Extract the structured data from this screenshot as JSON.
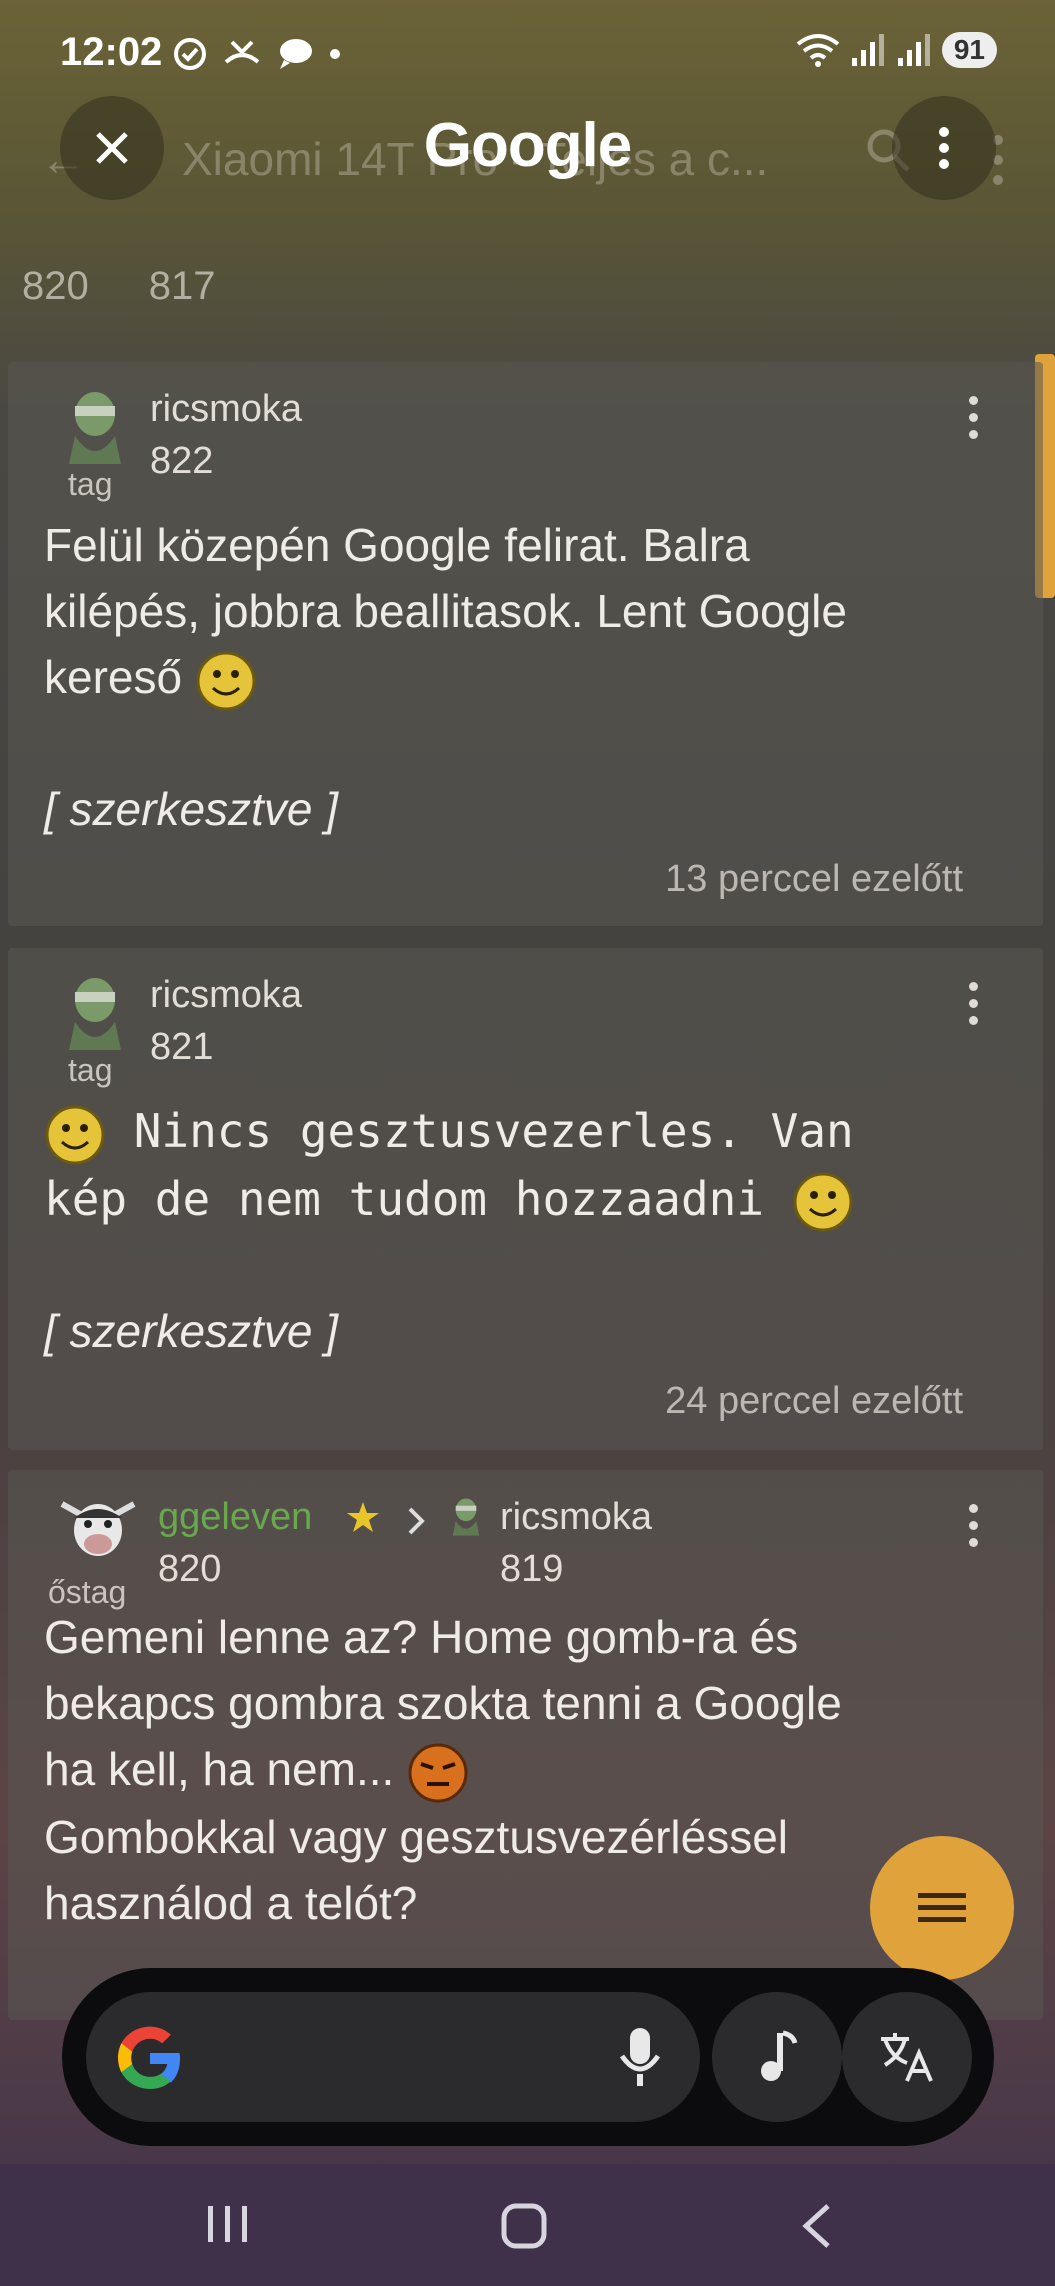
{
  "status_bar": {
    "time": "12:02",
    "battery": "91"
  },
  "header": {
    "title": "Google",
    "search_text": "Xiaomi 14T Pro - Teljes a c...",
    "close_icon": "close-icon",
    "menu_icon": "more-vert-icon"
  },
  "pages": [
    "820",
    "817"
  ],
  "posts": [
    {
      "author": "ricsmoka",
      "rank": "tag",
      "number": "822",
      "text_line1": "Felül közepén Google felirat. Balra",
      "text_line2": "kilépés, jobbra beallitasok. Lent Google",
      "text_line3": "kereső",
      "edited": "[ szerkesztve ]",
      "time": "13 perccel ezelőtt"
    },
    {
      "author": "ricsmoka",
      "rank": "tag",
      "number": "821",
      "text_line1": " Nincs gesztusvezerles. Van",
      "text_line2": "kép de nem tudom hozzaadni",
      "edited": "[ szerkesztve ]",
      "time": "24 perccel ezelőtt"
    },
    {
      "author": "ggeleven",
      "rank": "őstag",
      "number": "820",
      "reply_to_author": "ricsmoka",
      "reply_to_number": "819",
      "text_line1": "Gemeni lenne az? Home gomb-ra és",
      "text_line2": "bekapcs gombra szokta tenni a Google",
      "text_line3": "ha kell, ha nem...",
      "text_line4": "Gombokkal vagy gesztusvezérléssel",
      "text_line5": "használod a telót?"
    }
  ],
  "colors": {
    "accent": "#e0a23a",
    "author_highlight": "#6aa84f"
  }
}
